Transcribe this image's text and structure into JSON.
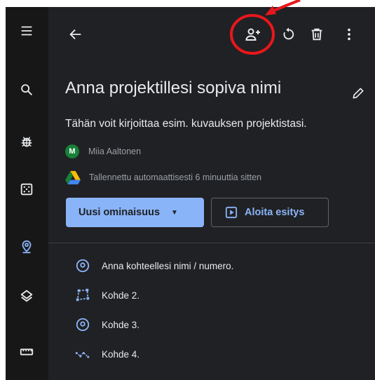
{
  "project": {
    "title": "Anna projektillesi sopiva nimi",
    "description": "Tähän voit kirjoittaa esim. kuvauksen projektistasi.",
    "owner_initial": "M",
    "owner_name": "Miia Aaltonen",
    "save_status": "Tallennettu automaattisesti 6 minuuttia sitten"
  },
  "actions": {
    "new_feature_label": "Uusi ominaisuus",
    "slideshow_label": "Aloita esitys"
  },
  "features": [
    {
      "label": "Anna kohteellesi nimi / numero.",
      "icon": "pin-icon"
    },
    {
      "label": "Kohde 2.",
      "icon": "polygon-icon"
    },
    {
      "label": "Kohde 3.",
      "icon": "pin-icon"
    },
    {
      "label": "Kohde 4.",
      "icon": "path-icon"
    }
  ],
  "rail_icons": [
    "menu-icon",
    "search-icon",
    "bug-icon",
    "dice-icon",
    "location-icon",
    "layers-icon",
    "ruler-icon"
  ],
  "toolbar_icons": [
    "back-icon",
    "share-icon",
    "history-icon",
    "delete-icon",
    "more-icon"
  ],
  "colors": {
    "background": "#202124",
    "rail": "#171717",
    "accent": "#8ab4f8",
    "avatar": "#188038",
    "annotation": "#e8171c"
  }
}
